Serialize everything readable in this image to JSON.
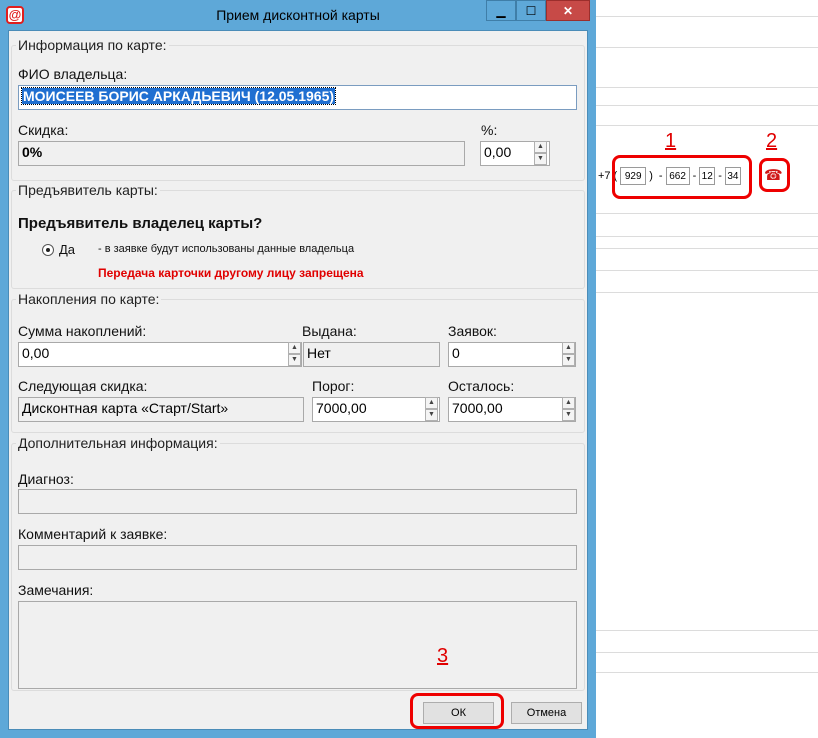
{
  "window": {
    "title": "Прием дисконтной карты",
    "app_icon_glyph": "@",
    "minimize_glyph": "▁",
    "maximize_glyph": "☐",
    "close_glyph": "✕"
  },
  "card_info": {
    "legend": "Информация по карте:",
    "owner_label": "ФИО владельца:",
    "owner_value": "МОИСЕЕВ БОРИС АРКАДЬЕВИЧ (12.05.1965)",
    "discount_label": "Скидка:",
    "discount_value": "0%",
    "percent_label": "%:",
    "percent_value": "0,00"
  },
  "presenter": {
    "legend": "Предъявитель карты:",
    "question": "Предъявитель владелец карты?",
    "option_label": "Да",
    "option_note": "- в заявке будут использованы данные владельца",
    "warning": "Передача карточки другому лицу запрещена"
  },
  "accumulation": {
    "legend": "Накопления по карте:",
    "sum_label": "Сумма накоплений:",
    "sum_value": "0,00",
    "issued_label": "Выдана:",
    "issued_value": "Нет",
    "requests_label": "Заявок:",
    "requests_value": "0",
    "next_label": "Следующая скидка:",
    "next_value": "Дисконтная карта «Старт/Start»",
    "threshold_label": "Порог:",
    "threshold_value": "7000,00",
    "remaining_label": "Осталось:",
    "remaining_value": "7000,00"
  },
  "extra": {
    "legend": "Дополнительная информация:",
    "diagnosis_label": "Диагноз:",
    "comment_label": "Комментарий к заявке:",
    "notes_label": "Замечания:"
  },
  "buttons": {
    "ok": "ОК",
    "cancel": "Отмена"
  },
  "phone": {
    "prefix": "+7",
    "open_paren": "(",
    "close_paren": ")",
    "dash": "-",
    "area": "929",
    "part1": "662",
    "part2": "12",
    "part3": "34",
    "phone_icon_glyph": "☎"
  },
  "annotations": {
    "n1": "1",
    "n2": "2",
    "n3": "3",
    "color": "#ee0000"
  },
  "colors": {
    "titlebar": "#5ea8d8",
    "close_button": "#c74a47",
    "selection": "#1f6fd1",
    "warning_text": "#e00000"
  }
}
